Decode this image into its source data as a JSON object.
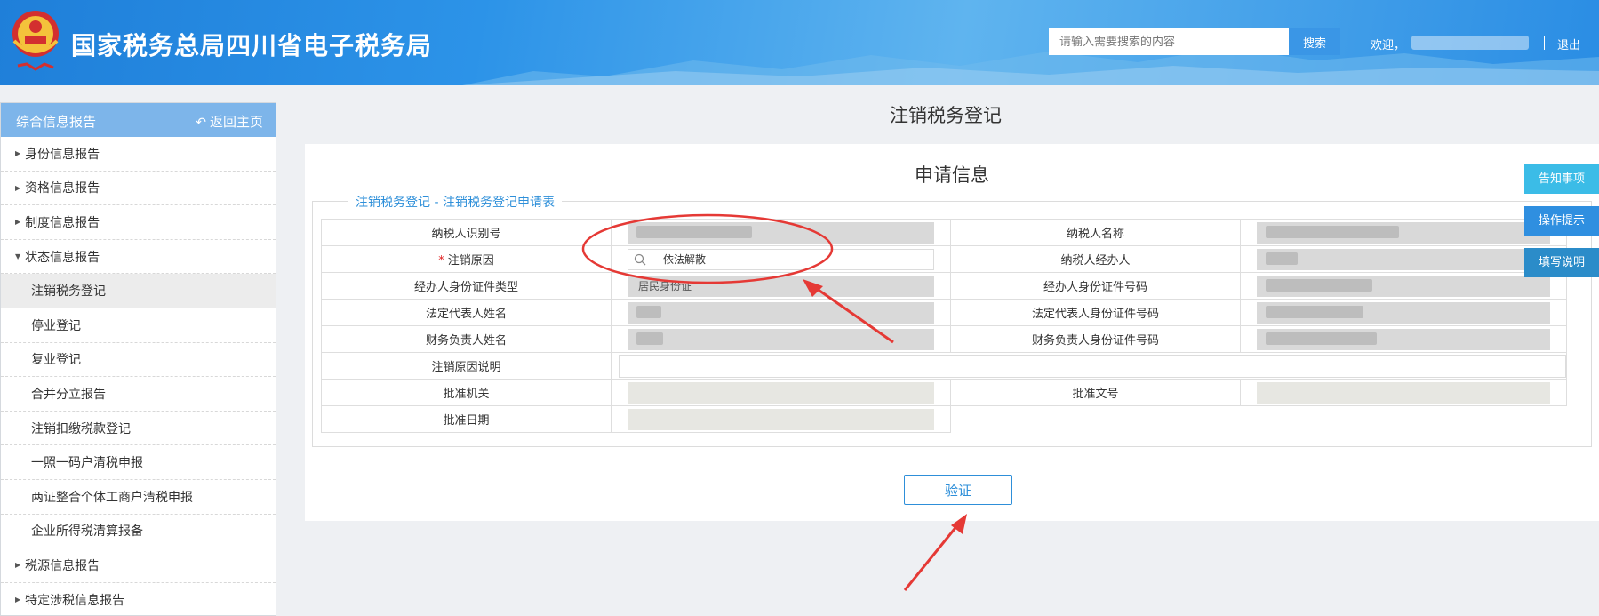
{
  "header": {
    "site_title": "国家税务总局四川省电子税务局",
    "search_placeholder": "请输入需要搜索的内容",
    "search_button": "搜索",
    "welcome": "欢迎，",
    "logout": "退出"
  },
  "sidebar": {
    "title": "综合信息报告",
    "back_label": "返回主页",
    "items": [
      {
        "label": "身份信息报告"
      },
      {
        "label": "资格信息报告"
      },
      {
        "label": "制度信息报告"
      },
      {
        "label": "状态信息报告"
      },
      {
        "label": "注销税务登记"
      },
      {
        "label": "停业登记"
      },
      {
        "label": "复业登记"
      },
      {
        "label": "合并分立报告"
      },
      {
        "label": "注销扣缴税款登记"
      },
      {
        "label": "一照一码户清税申报"
      },
      {
        "label": "两证整合个体工商户清税申报"
      },
      {
        "label": "企业所得税清算报备"
      },
      {
        "label": "税源信息报告"
      },
      {
        "label": "特定涉税信息报告"
      }
    ]
  },
  "main": {
    "page_title": "注销税务登记",
    "panel_title": "申请信息",
    "legend": "注销税务登记 - 注销税务登记申请表",
    "verify_button": "验证"
  },
  "form": {
    "taxpayer_id_label": "纳税人识别号",
    "taxpayer_name_label": "纳税人名称",
    "reason_label": "注销原因",
    "reason_value": "依法解散",
    "agent_label": "纳税人经办人",
    "agent_id_type_label": "经办人身份证件类型",
    "agent_id_type_value": "居民身份证",
    "agent_id_no_label": "经办人身份证件号码",
    "legal_rep_name_label": "法定代表人姓名",
    "legal_rep_id_label": "法定代表人身份证件号码",
    "finance_name_label": "财务负责人姓名",
    "finance_id_label": "财务负责人身份证件号码",
    "reason_desc_label": "注销原因说明",
    "approval_org_label": "批准机关",
    "approval_no_label": "批准文号",
    "approval_date_label": "批准日期"
  },
  "float_buttons": {
    "notice": "告知事项",
    "tips": "操作提示",
    "guide": "填写说明"
  },
  "colors": {
    "header_blue": "#2c93e8",
    "accent": "#2e8fd9",
    "required": "#e02020",
    "annotation_red": "#e53935"
  }
}
